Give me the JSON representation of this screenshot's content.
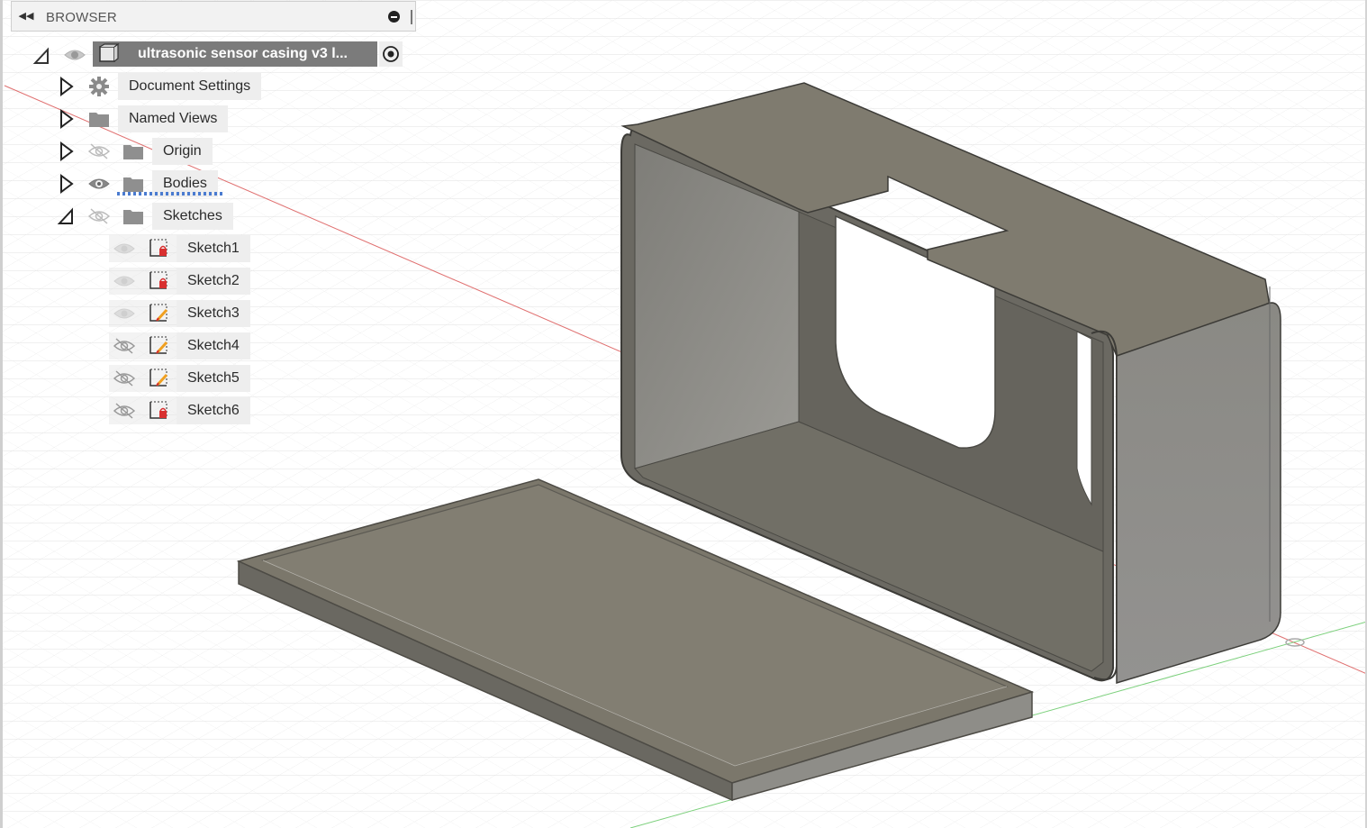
{
  "browser": {
    "title": "BROWSER",
    "root": {
      "label": "ultrasonic sensor casing v3 l..."
    },
    "items": [
      {
        "label": "Document Settings"
      },
      {
        "label": "Named Views"
      },
      {
        "label": "Origin"
      },
      {
        "label": "Bodies"
      },
      {
        "label": "Sketches"
      }
    ],
    "sketches": [
      {
        "label": "Sketch1",
        "visibility": "visible-dim",
        "icon": "sketch-locked-icon"
      },
      {
        "label": "Sketch2",
        "visibility": "visible-dim",
        "icon": "sketch-locked-icon"
      },
      {
        "label": "Sketch3",
        "visibility": "visible-dim",
        "icon": "sketch-edit-icon"
      },
      {
        "label": "Sketch4",
        "visibility": "hidden",
        "icon": "sketch-edit-icon"
      },
      {
        "label": "Sketch5",
        "visibility": "hidden",
        "icon": "sketch-edit-icon"
      },
      {
        "label": "Sketch6",
        "visibility": "hidden",
        "icon": "sketch-locked-icon"
      }
    ]
  },
  "colors": {
    "body_top": "#7f7b6f",
    "body_dark": "#615e55",
    "body_side": "#8f8e88",
    "grid": "#dcdcdc",
    "axis_x": "#e06060",
    "axis_y": "#60c060"
  }
}
